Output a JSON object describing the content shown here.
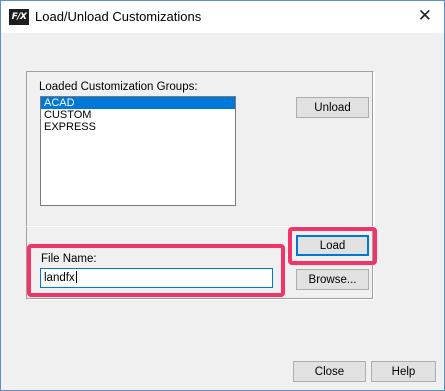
{
  "window": {
    "title": "Load/Unload Customizations",
    "app_icon_text": "F/X",
    "close_glyph": "✕"
  },
  "groups": {
    "label": "Loaded Customization Groups:",
    "items": [
      {
        "label": "ACAD",
        "selected": true
      },
      {
        "label": "CUSTOM",
        "selected": false
      },
      {
        "label": "EXPRESS",
        "selected": false
      }
    ],
    "unload_label": "Unload"
  },
  "file": {
    "label": "File Name:",
    "value": "landfx"
  },
  "buttons": {
    "load_label": "Load",
    "browse_label": "Browse...",
    "close_label": "Close",
    "help_label": "Help"
  },
  "colors": {
    "highlight": "#f03569",
    "selection": "#0078d7"
  }
}
